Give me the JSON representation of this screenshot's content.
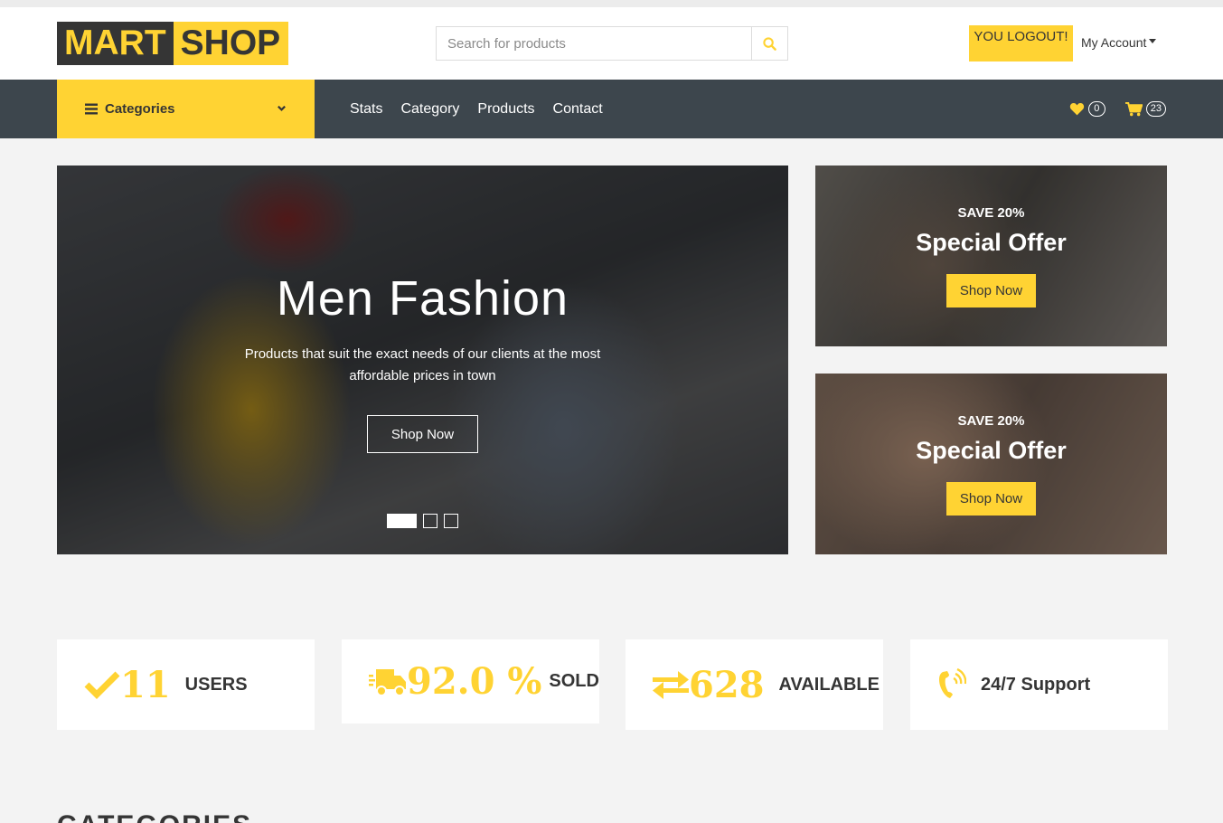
{
  "header": {
    "logo_part1": "MART",
    "logo_part2": "SHOP",
    "search_placeholder": "Search for products",
    "logout_label": "YOU LOGOUT!",
    "account_label": "My Account"
  },
  "nav": {
    "categories_label": "Categories",
    "links": [
      "Stats",
      "Category",
      "Products",
      "Contact"
    ],
    "wishlist_count": "0",
    "cart_count": "23"
  },
  "hero": {
    "title": "Men Fashion",
    "subtitle": "Products that suit the exact needs of our clients at the most affordable prices in town",
    "button": "Shop Now",
    "slides": 3,
    "active_slide": 1
  },
  "offers": [
    {
      "save": "SAVE 20%",
      "title": "Special Offer",
      "button": "Shop Now"
    },
    {
      "save": "SAVE 20%",
      "title": "Special Offer",
      "button": "Shop Now"
    }
  ],
  "stats": [
    {
      "icon": "check-icon",
      "value": "11",
      "label": "USERS"
    },
    {
      "icon": "truck-icon",
      "value": "92.0 %",
      "label": "SOLD"
    },
    {
      "icon": "exchange-icon",
      "value": "628",
      "label": "AVAILABLE"
    },
    {
      "icon": "phone-volume-icon",
      "value": "",
      "label": "24/7 Support"
    }
  ],
  "sections": {
    "categories_title": "CATEGORIES"
  },
  "colors": {
    "accent": "#ffd333",
    "dark": "#3d464d",
    "text": "#353535"
  }
}
